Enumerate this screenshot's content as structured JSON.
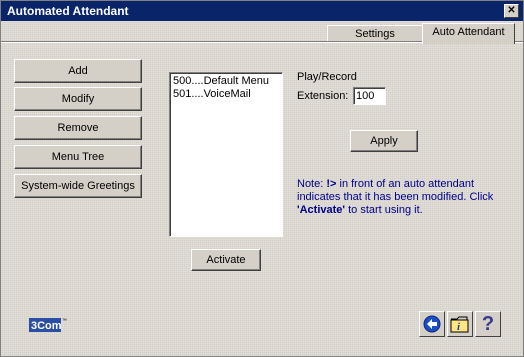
{
  "window": {
    "title": "Automated Attendant",
    "close_glyph": "✕"
  },
  "tabs": [
    {
      "label": "Settings",
      "active": false
    },
    {
      "label": "Auto Attendant",
      "active": true
    }
  ],
  "sidebar": {
    "buttons": [
      {
        "label": "Add"
      },
      {
        "label": "Modify"
      },
      {
        "label": "Remove"
      },
      {
        "label": "Menu Tree"
      },
      {
        "label": "System-wide Greetings"
      }
    ]
  },
  "attendant_list": {
    "items": [
      {
        "text": "500....Default Menu"
      },
      {
        "text": "501....VoiceMail"
      }
    ]
  },
  "activate_button": "Activate",
  "play_record": {
    "heading": "Play/Record",
    "extension_label": "Extension:",
    "extension_value": "100"
  },
  "apply_button": "Apply",
  "note": {
    "prefix": "Note: ",
    "marker": "!>",
    "middle": " in front of an auto attendant indicates that it has been modified. Click ",
    "activate_word": "'Activate'",
    "suffix": " to start using it."
  },
  "footer": {
    "logo_text": "3Com",
    "icons": [
      "back-arrow-icon",
      "folder-icon",
      "help-icon"
    ],
    "help_glyph": "?"
  },
  "colors": {
    "titlebar": "#0a246a",
    "note_text": "#00008b",
    "logo_blue": "#2b4fa2"
  }
}
